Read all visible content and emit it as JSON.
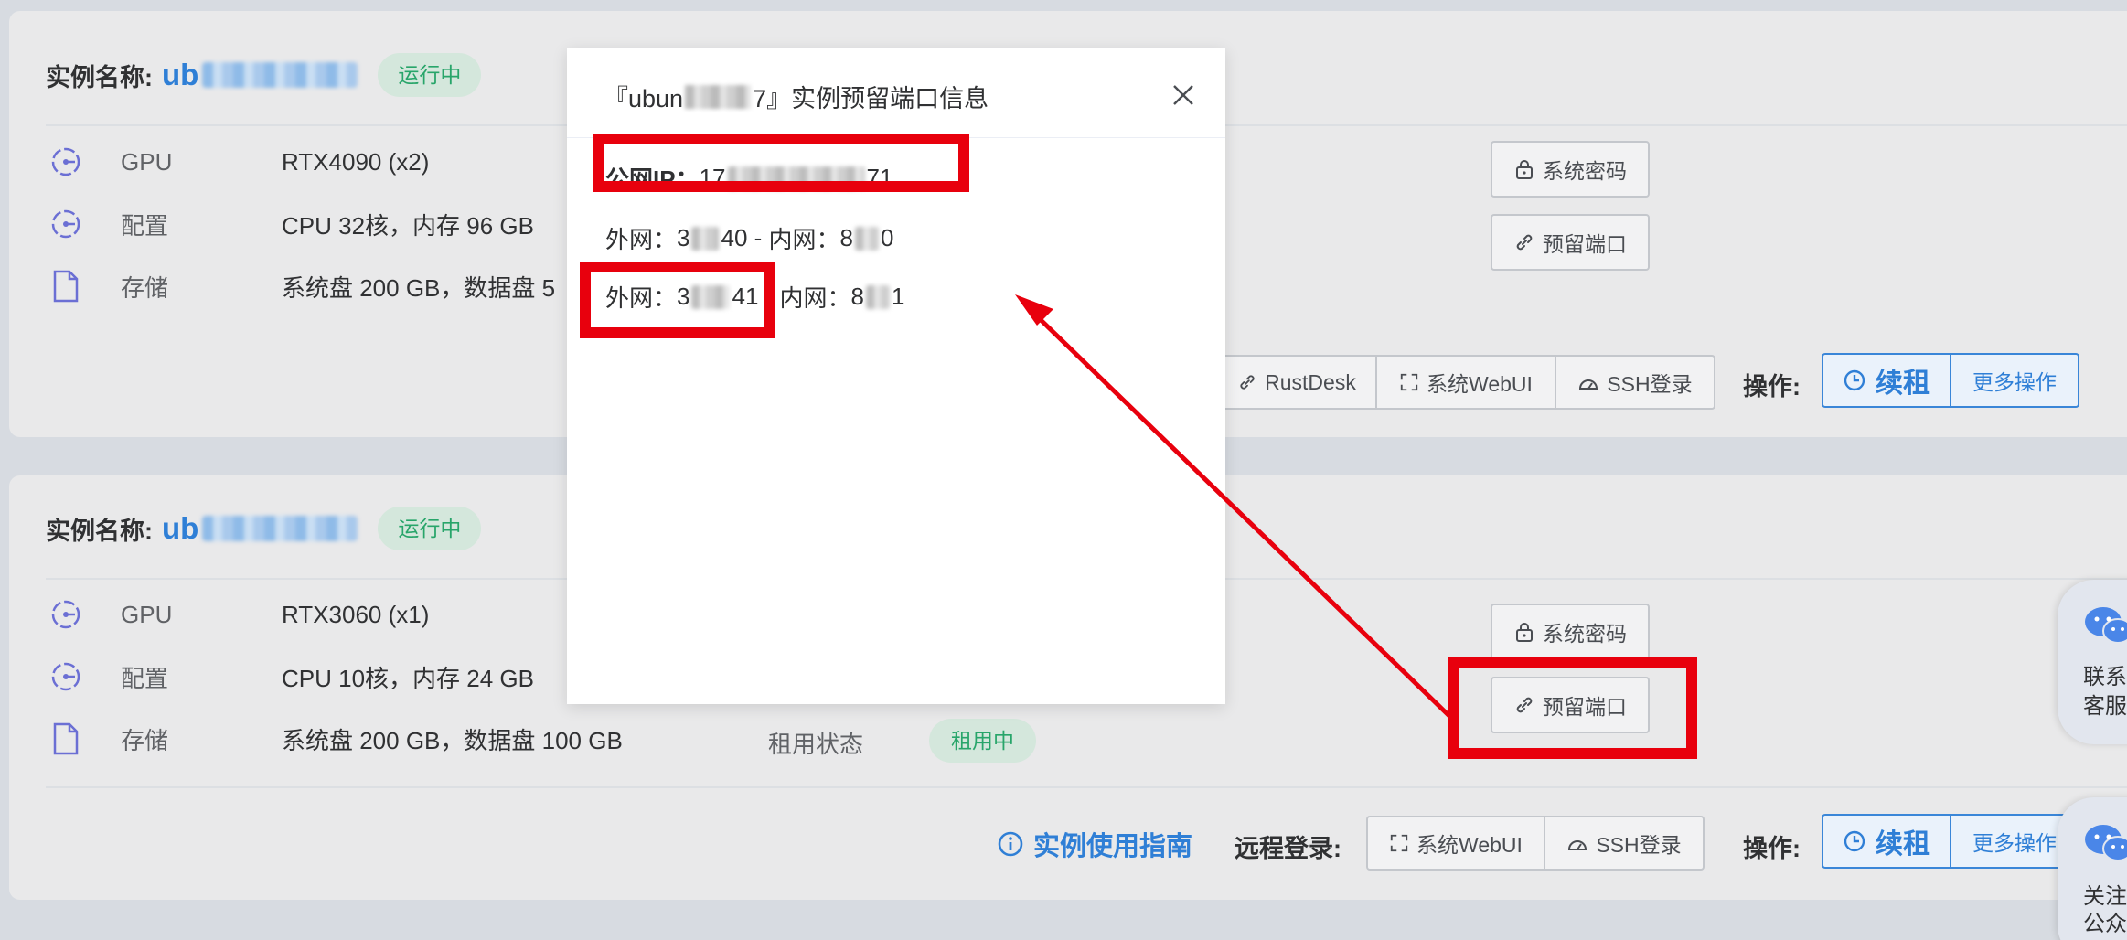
{
  "instances": [
    {
      "label": "实例名称:",
      "name_prefix": "ub",
      "status": "运行中",
      "specs": [
        {
          "key": "GPU",
          "value": "RTX4090 (x2)",
          "icon": "gpu-gear-icon"
        },
        {
          "key": "配置",
          "value": "CPU 32核，内存 96 GB",
          "icon": "config-gear-icon"
        },
        {
          "key": "存储",
          "value": "系统盘 200 GB，数据盘 5",
          "icon": "file-icon"
        }
      ],
      "buttons": {
        "password": "系统密码",
        "port": "预留端口"
      },
      "remote": [
        "RustDesk",
        "系统WebUI",
        "SSH登录"
      ],
      "op_label": "操作:",
      "renew": "续租",
      "more": "更多操作"
    },
    {
      "label": "实例名称:",
      "name_prefix": "ub",
      "status": "运行中",
      "specs": [
        {
          "key": "GPU",
          "value": "RTX3060 (x1)",
          "icon": "gpu-gear-icon"
        },
        {
          "key": "配置",
          "value": "CPU 10核，内存 24 GB",
          "icon": "config-gear-icon"
        },
        {
          "key": "存储",
          "value": "系统盘 200 GB，数据盘 100 GB",
          "icon": "file-icon"
        }
      ],
      "rent_label": "租用状态",
      "rent_status": "租用中",
      "buttons": {
        "password": "系统密码",
        "port": "预留端口"
      },
      "guide": "实例使用指南",
      "remote_label": "远程登录:",
      "remote": [
        "系统WebUI",
        "SSH登录"
      ],
      "op_label": "操作:",
      "renew": "续租",
      "more": "更多操作"
    }
  ],
  "modal": {
    "title_prefix": "『ubun",
    "title_suffix": "7』实例预留端口信息",
    "ip_label": "公网IP：",
    "ip_start": "17",
    "ip_end": "71",
    "port_rows": [
      {
        "ext_label": "外网：",
        "ext_start": "3",
        "ext_end": "40",
        "sep": " - ",
        "int_label": "内网：",
        "int_start": "8",
        "int_end": "0"
      },
      {
        "ext_label": "外网：",
        "ext_start": "3",
        "ext_end": "41",
        "sep": " - ",
        "int_label": "内网：",
        "int_start": "8",
        "int_end": "1"
      }
    ]
  },
  "float_widgets": [
    {
      "text1": "联系",
      "text2": "客服",
      "icon": "wechat-icon"
    },
    {
      "text1": "关注",
      "text2": "公众号",
      "icon": "wechat-icon"
    }
  ],
  "colors": {
    "accent": "#2f7fd6",
    "success": "#28a56a",
    "annotation": "#e8000d"
  }
}
